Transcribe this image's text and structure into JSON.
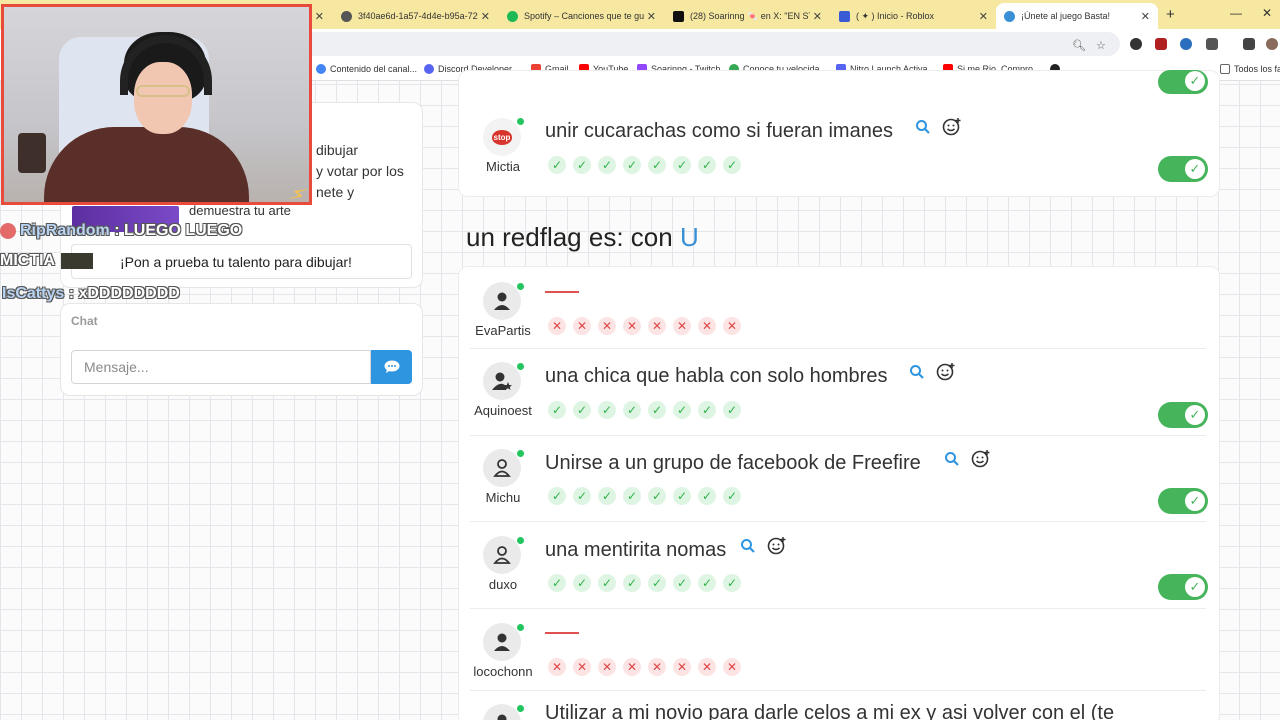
{
  "browser": {
    "tabs": [
      {
        "title": "",
        "color": "#999999"
      },
      {
        "title": "3f40ae6d-1a57-4d4e-b95a-72f",
        "color": "#555555"
      },
      {
        "title": "Spotify – Canciones que te gust",
        "color": "#1db954"
      },
      {
        "title": "(28) Soarinng 🍬 en X: \"EN STR",
        "color": "#111111"
      },
      {
        "title": "( ✦ ) Inicio - Roblox",
        "color": "#3a5bd6"
      },
      {
        "title": "¡Únete al juego Basta!",
        "color": "#3b8fd6"
      }
    ],
    "new_tab": "+",
    "win_minimize": "—",
    "win_close": "✕",
    "bookmarks": [
      {
        "label": "Contenido del canal...",
        "color": "#4285f4"
      },
      {
        "label": "Discord Developer...",
        "color": "#5865f2"
      },
      {
        "label": "Gmail",
        "color": "#ea4335"
      },
      {
        "label": "YouTube",
        "color": "#ff0000"
      },
      {
        "label": "Soarinng - Twitch",
        "color": "#9146ff"
      },
      {
        "label": "Conoce tu velocida...",
        "color": "#34a853"
      },
      {
        "label": "Nitro Launch Activa...",
        "color": "#5865f2"
      },
      {
        "label": "Si me Rio, Compro...",
        "color": "#ff0000"
      },
      {
        "label": "",
        "color": "#222222"
      }
    ],
    "all_bookmarks": "Todos los fa"
  },
  "side": {
    "desc_lines": [
      "dibujar",
      "y votar por los",
      "nete y"
    ],
    "desc_last": "demuestra tu arte",
    "promo_text": "¡Pon a prueba tu talento para dibujar!",
    "chat_label": "Chat",
    "message_placeholder": "Mensaje..."
  },
  "stream_chat": [
    {
      "user": "RipRandom",
      "text": ": LUEGO LUEGO"
    },
    {
      "user": "MICTIA",
      "text": "¡Pon a prueba tu talento para dibujar!"
    },
    {
      "user": "IsCattys",
      "text": ": xDDDDDDDD"
    }
  ],
  "game": {
    "previous_answer": {
      "player": "Mictia",
      "text": "unir cucarachas como si fueran imanes",
      "votes": [
        "yes",
        "yes",
        "yes",
        "yes",
        "yes",
        "yes",
        "yes",
        "yes"
      ],
      "accepted": true
    },
    "category": {
      "prefix": "un redflag es: con",
      "letter": "U"
    },
    "answers": [
      {
        "player": "EvaPartis",
        "text": "",
        "votes": [
          "no",
          "no",
          "no",
          "no",
          "no",
          "no",
          "no",
          "no"
        ],
        "accepted": false,
        "empty": true
      },
      {
        "player": "Aquinoest",
        "text": "una chica que habla con solo hombres",
        "votes": [
          "yes",
          "yes",
          "yes",
          "yes",
          "yes",
          "yes",
          "yes",
          "yes"
        ],
        "accepted": true,
        "empty": false
      },
      {
        "player": "Michu",
        "text": "Unirse a un grupo de facebook de Freefire",
        "votes": [
          "yes",
          "yes",
          "yes",
          "yes",
          "yes",
          "yes",
          "yes",
          "yes"
        ],
        "accepted": true,
        "empty": false
      },
      {
        "player": "duxo",
        "text": "una mentirita nomas",
        "votes": [
          "yes",
          "yes",
          "yes",
          "yes",
          "yes",
          "yes",
          "yes",
          "yes"
        ],
        "accepted": true,
        "empty": false
      },
      {
        "player": "locochonn",
        "text": "",
        "votes": [
          "no",
          "no",
          "no",
          "no",
          "no",
          "no",
          "no",
          "no"
        ],
        "accepted": false,
        "empty": true
      },
      {
        "player": "",
        "text": "Utilizar a mi novio para darle celos a mi ex y asi volver con el (te",
        "votes": [],
        "accepted": false,
        "empty": false
      }
    ]
  }
}
